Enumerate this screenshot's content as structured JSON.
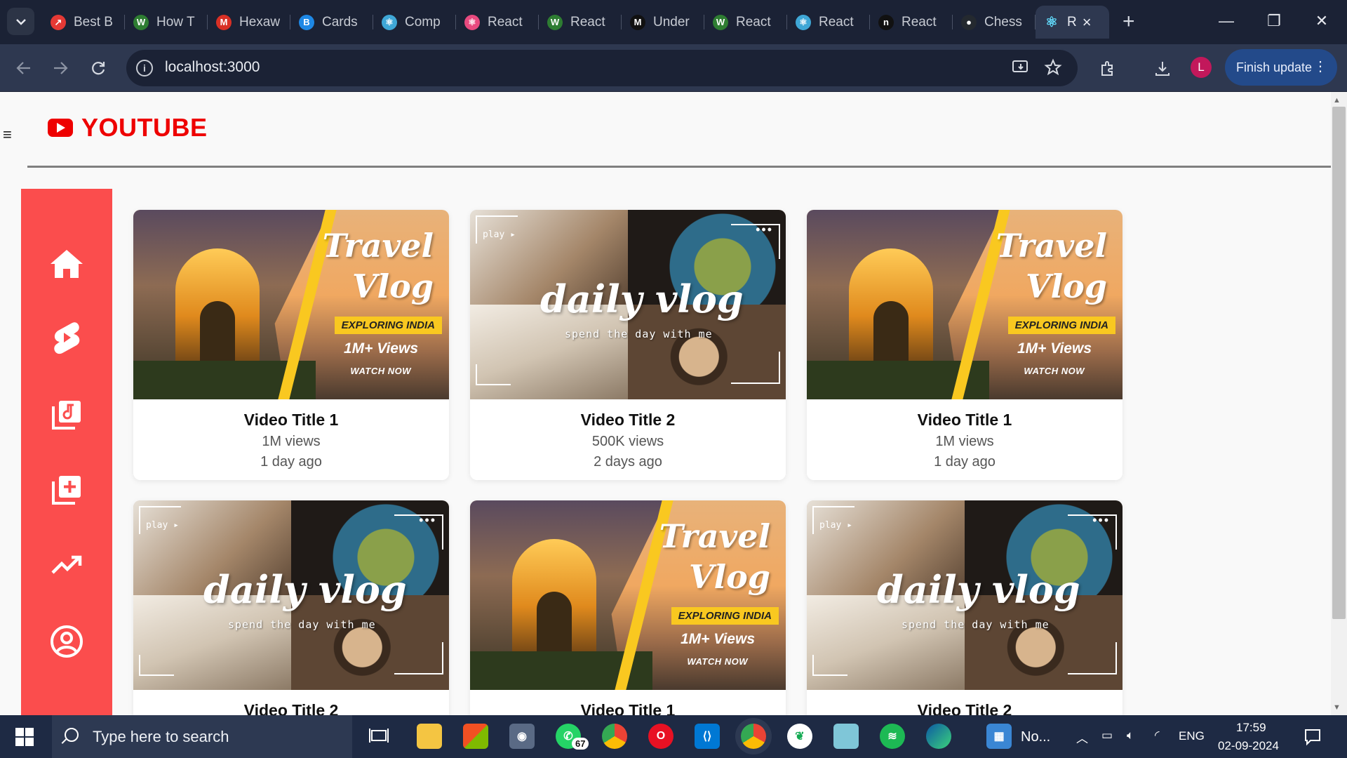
{
  "browser": {
    "tabs": [
      {
        "title": "Best B",
        "icon_color": "#e53935",
        "icon_glyph": "↗"
      },
      {
        "title": "How T",
        "icon_color": "#2e7d32",
        "icon_glyph": "W"
      },
      {
        "title": "Hexaw",
        "icon_color": "#d93025",
        "icon_glyph": "M"
      },
      {
        "title": "Cards",
        "icon_color": "#1e88e5",
        "icon_glyph": "B"
      },
      {
        "title": "Comp",
        "icon_color": "#3fa7d6",
        "icon_glyph": "⚛"
      },
      {
        "title": "React",
        "icon_color": "#e84a7f",
        "icon_glyph": "⚛"
      },
      {
        "title": "React",
        "icon_color": "#2e7d32",
        "icon_glyph": "W"
      },
      {
        "title": "Under",
        "icon_color": "#111111",
        "icon_glyph": "M"
      },
      {
        "title": "React",
        "icon_color": "#2e7d32",
        "icon_glyph": "W"
      },
      {
        "title": "React",
        "icon_color": "#3fa7d6",
        "icon_glyph": "⚛"
      },
      {
        "title": "React",
        "icon_color": "#111111",
        "icon_glyph": "n"
      },
      {
        "title": "Chess",
        "icon_color": "#24292f",
        "icon_glyph": "●"
      }
    ],
    "active_tab": {
      "title": "R",
      "close": "×",
      "icon_glyph": "⚛"
    },
    "new_tab": "+",
    "window": {
      "minimize": "—",
      "restore": "❐",
      "close": "✕"
    },
    "url": "localhost:3000",
    "profile_initial": "L",
    "finish_update": "Finish update",
    "menu_dots": "⋮"
  },
  "page": {
    "brand": "YOUTUBE",
    "hamburger": "≡",
    "sidebar": [
      {
        "name": "home-icon"
      },
      {
        "name": "shorts-icon"
      },
      {
        "name": "music-library-icon"
      },
      {
        "name": "add-playlist-icon"
      },
      {
        "name": "trending-icon"
      },
      {
        "name": "account-icon"
      }
    ],
    "travel_thumb": {
      "title_line1": "Travel",
      "title_line2": "Vlog",
      "tag": "EXPLORING INDIA",
      "views": "1M+ Views",
      "cta": "WATCH NOW"
    },
    "daily_thumb": {
      "play": "play ▸",
      "title": "daily vlog",
      "subtitle": "spend the day with me",
      "dots": "•••"
    },
    "videos": [
      {
        "title": "Video Title 1",
        "views": "1M views",
        "time": "1 day ago",
        "thumb": "travel"
      },
      {
        "title": "Video Title 2",
        "views": "500K views",
        "time": "2 days ago",
        "thumb": "daily"
      },
      {
        "title": "Video Title 1",
        "views": "1M views",
        "time": "1 day ago",
        "thumb": "travel"
      },
      {
        "title": "Video Title 2",
        "views": "",
        "time": "",
        "thumb": "daily"
      },
      {
        "title": "Video Title 1",
        "views": "",
        "time": "",
        "thumb": "travel"
      },
      {
        "title": "Video Title 2",
        "views": "",
        "time": "",
        "thumb": "daily"
      }
    ]
  },
  "taskbar": {
    "search_placeholder": "Type here to search",
    "whatsapp_badge": "67",
    "pinned_label": "No...",
    "language": "ENG",
    "time": "17:59",
    "date": "02-09-2024"
  }
}
